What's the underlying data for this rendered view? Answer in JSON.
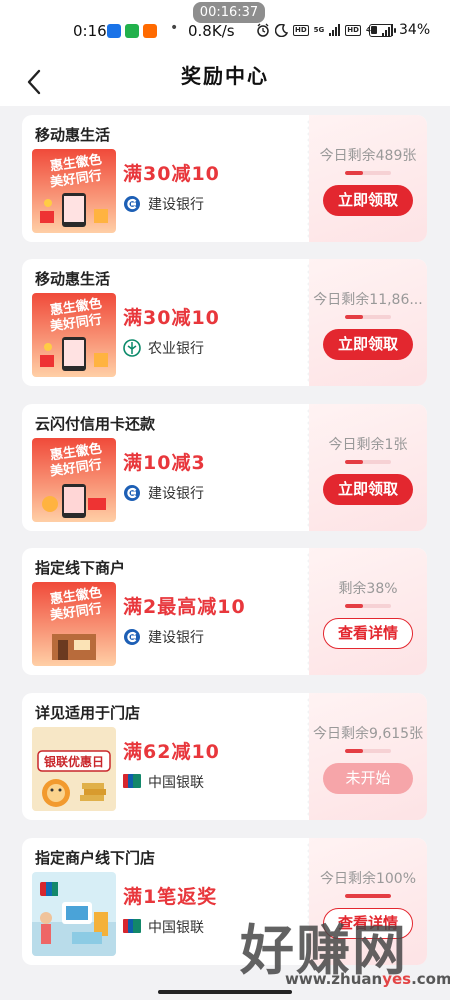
{
  "status_bar": {
    "screen_recording_time": "00:16:37",
    "time": "0:16",
    "network_speed": "0.8K/s",
    "signal_labels": [
      "HD",
      "5G",
      "HD",
      "4G"
    ],
    "battery_percent": "34%",
    "battery_level": 0.34
  },
  "header": {
    "title": "奖励中心",
    "back_icon": "chevron-left-icon"
  },
  "colors": {
    "accent": "#e3272f",
    "offer_text": "#e8373c",
    "disabled_button": "#f6a5a9"
  },
  "cards": [
    {
      "title": "移动惠生活",
      "offer": "满30减10",
      "bank": "建设银行",
      "remaining": "今日剩余489张",
      "progress": 0.0,
      "button": "立即领取",
      "button_state": "active",
      "thumb": "promo-ccb"
    },
    {
      "title": "移动惠生活",
      "offer": "满30减10",
      "bank": "农业银行",
      "remaining": "今日剩余11,86...",
      "progress": 0.0,
      "button": "立即领取",
      "button_state": "active",
      "thumb": "promo-abc"
    },
    {
      "title": "云闪付信用卡还款",
      "offer": "满10减3",
      "bank": "建设银行",
      "remaining": "今日剩余1张",
      "progress": 0.0,
      "button": "立即领取",
      "button_state": "active",
      "thumb": "promo-repay"
    },
    {
      "title": "指定线下商户",
      "offer": "满2最高减10",
      "bank": "建设银行",
      "remaining": "剩余38%",
      "progress": 0.38,
      "button": "查看详情",
      "button_state": "outline",
      "thumb": "promo-store"
    },
    {
      "title": "详见适用于门店",
      "offer": "满62减10",
      "bank": "中国银联",
      "remaining": "今日剩余9,615张",
      "progress": 0.0,
      "button": "未开始",
      "button_state": "disabled",
      "thumb": "promo-unionpay-day"
    },
    {
      "title": "指定商户线下门店",
      "offer": "满1笔返奖",
      "bank": "中国银联",
      "remaining": "今日剩余100%",
      "progress": 1.0,
      "button": "查看详情",
      "button_state": "outline",
      "thumb": "promo-unionpay-store"
    }
  ],
  "thumb_text": {
    "promo_line1": "惠生徽色",
    "promo_line2": "美好同行",
    "unionpay_day": "银联优惠日"
  },
  "watermark": {
    "logo": "好赚网",
    "url_part1": "www.zhuan",
    "url_part2": "yes",
    "url_part3": ".com"
  }
}
